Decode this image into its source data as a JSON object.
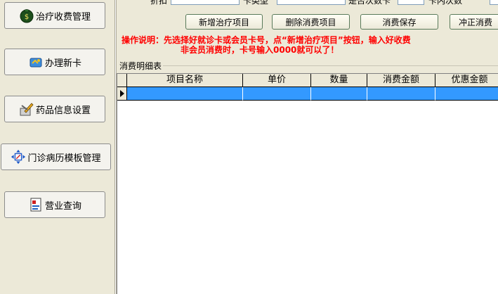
{
  "sidebar": {
    "items": [
      {
        "label": "治疗收费管理",
        "icon": "money-bag-icon"
      },
      {
        "label": "办理新卡",
        "icon": "new-card-icon"
      },
      {
        "label": "药品信息设置",
        "icon": "drug-settings-icon"
      },
      {
        "label": "门诊病历模板管理",
        "icon": "template-icon"
      },
      {
        "label": "营业查询",
        "icon": "report-icon"
      }
    ]
  },
  "top_fields": {
    "discount_label": "折扣",
    "card_type_label": "卡类型",
    "use_count_label": "是否次数卡",
    "card_count_label": "卡内次数"
  },
  "actions": {
    "add": "新增治疗项目",
    "delete": "删除消费项目",
    "save": "消费保存",
    "reverse": "冲正消费"
  },
  "instructions": {
    "line1": "操作说明：先选择好就诊卡或会员卡号，点“新增治疗项目”按钮，输入好收费",
    "line2": "非会员消费时，卡号输入0000就可以了！"
  },
  "group_title": "消费明细表",
  "table": {
    "columns": [
      "项目名称",
      "单价",
      "数量",
      "消费金额",
      "优惠金额"
    ],
    "rows": [
      [
        "",
        "",
        "",
        "",
        ""
      ]
    ]
  },
  "colors": {
    "instruction_text": "#ff0000",
    "selected_row": "#3399ff",
    "panel_background": "#ece9d8"
  }
}
